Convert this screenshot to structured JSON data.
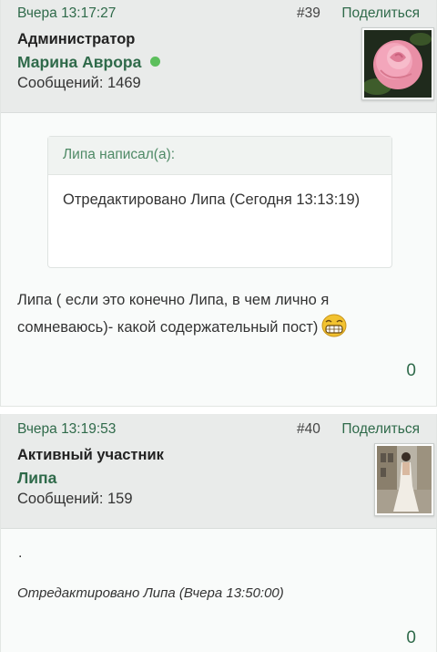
{
  "posts": [
    {
      "date": "Вчера 13:17:27",
      "number": "#39",
      "share_label": "Поделиться",
      "role": "Администратор",
      "author": "Марина Аврора",
      "messages": "Сообщений: 1469",
      "avatar_icon": "pink-rose-avatar",
      "quote": {
        "header": "Липа написал(а):",
        "text": "Отредактировано Липа (Сегодня 13:13:19)"
      },
      "text": "Липа ( если это конечно Липа, в чем лично я сомневаюсь)- какой содержательный пост)",
      "emoji": "grinning-face-icon",
      "likes": "0"
    },
    {
      "date": "Вчера 13:19:53",
      "number": "#40",
      "share_label": "Поделиться",
      "role": "Активный участник",
      "author": "Липа",
      "messages": "Сообщений: 159",
      "avatar_icon": "bride-photo-avatar",
      "text": ".",
      "edited": "Отредактировано Липа (Вчера 13:50:00)",
      "likes": "0"
    }
  ],
  "colors": {
    "accent": "#2f6a4a",
    "header_bg": "#e9ebea",
    "online": "#5cbf5c"
  }
}
